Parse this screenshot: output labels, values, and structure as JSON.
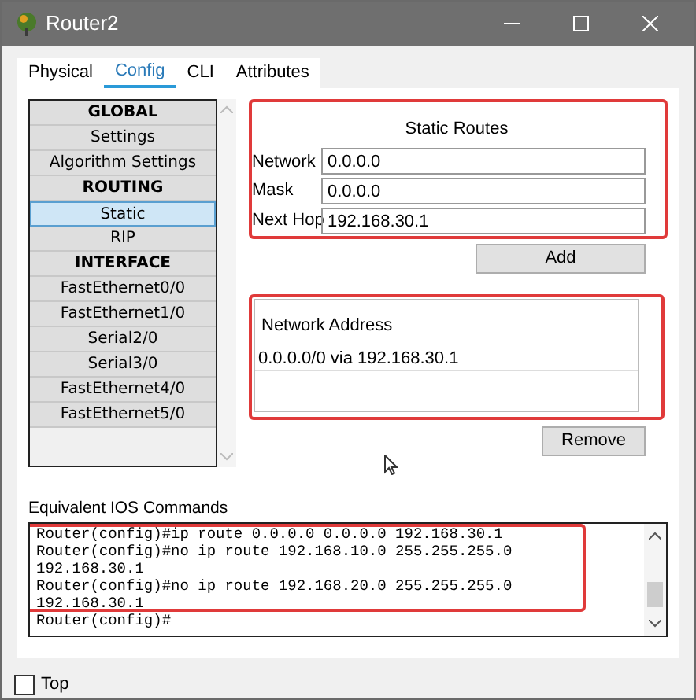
{
  "window": {
    "title": "Router2"
  },
  "tabs": [
    {
      "label": "Physical",
      "selected": false
    },
    {
      "label": "Config",
      "selected": true
    },
    {
      "label": "CLI",
      "selected": false
    },
    {
      "label": "Attributes",
      "selected": false
    }
  ],
  "sidebar": {
    "items": [
      {
        "label": "GLOBAL",
        "kind": "header",
        "selected": false
      },
      {
        "label": "Settings",
        "kind": "item",
        "selected": false
      },
      {
        "label": "Algorithm Settings",
        "kind": "item",
        "selected": false
      },
      {
        "label": "ROUTING",
        "kind": "header",
        "selected": false
      },
      {
        "label": "Static",
        "kind": "item",
        "selected": true
      },
      {
        "label": "RIP",
        "kind": "item",
        "selected": false
      },
      {
        "label": "INTERFACE",
        "kind": "header",
        "selected": false
      },
      {
        "label": "FastEthernet0/0",
        "kind": "item",
        "selected": false
      },
      {
        "label": "FastEthernet1/0",
        "kind": "item",
        "selected": false
      },
      {
        "label": "Serial2/0",
        "kind": "item",
        "selected": false
      },
      {
        "label": "Serial3/0",
        "kind": "item",
        "selected": false
      },
      {
        "label": "FastEthernet4/0",
        "kind": "item",
        "selected": false
      },
      {
        "label": "FastEthernet5/0",
        "kind": "item",
        "selected": false
      }
    ]
  },
  "static_routes": {
    "title": "Static Routes",
    "fields": [
      {
        "label": "Network",
        "value": "0.0.0.0"
      },
      {
        "label": "Mask",
        "value": "0.0.0.0"
      },
      {
        "label": "Next Hop",
        "value": "192.168.30.1"
      }
    ],
    "add_button": "Add"
  },
  "network_address": {
    "heading": "Network Address",
    "rows": [
      "0.0.0.0/0 via 192.168.30.1"
    ],
    "remove_button": "Remove"
  },
  "ios_commands": {
    "label": "Equivalent IOS Commands",
    "lines": [
      "Router(config)#ip route 0.0.0.0 0.0.0.0 192.168.30.1",
      "Router(config)#no ip route 192.168.10.0 255.255.255.0",
      "192.168.30.1",
      "Router(config)#no ip route 192.168.20.0 255.255.255.0",
      "192.168.30.1",
      "Router(config)#"
    ]
  },
  "top_checkbox": {
    "label": "Top",
    "checked": false
  }
}
